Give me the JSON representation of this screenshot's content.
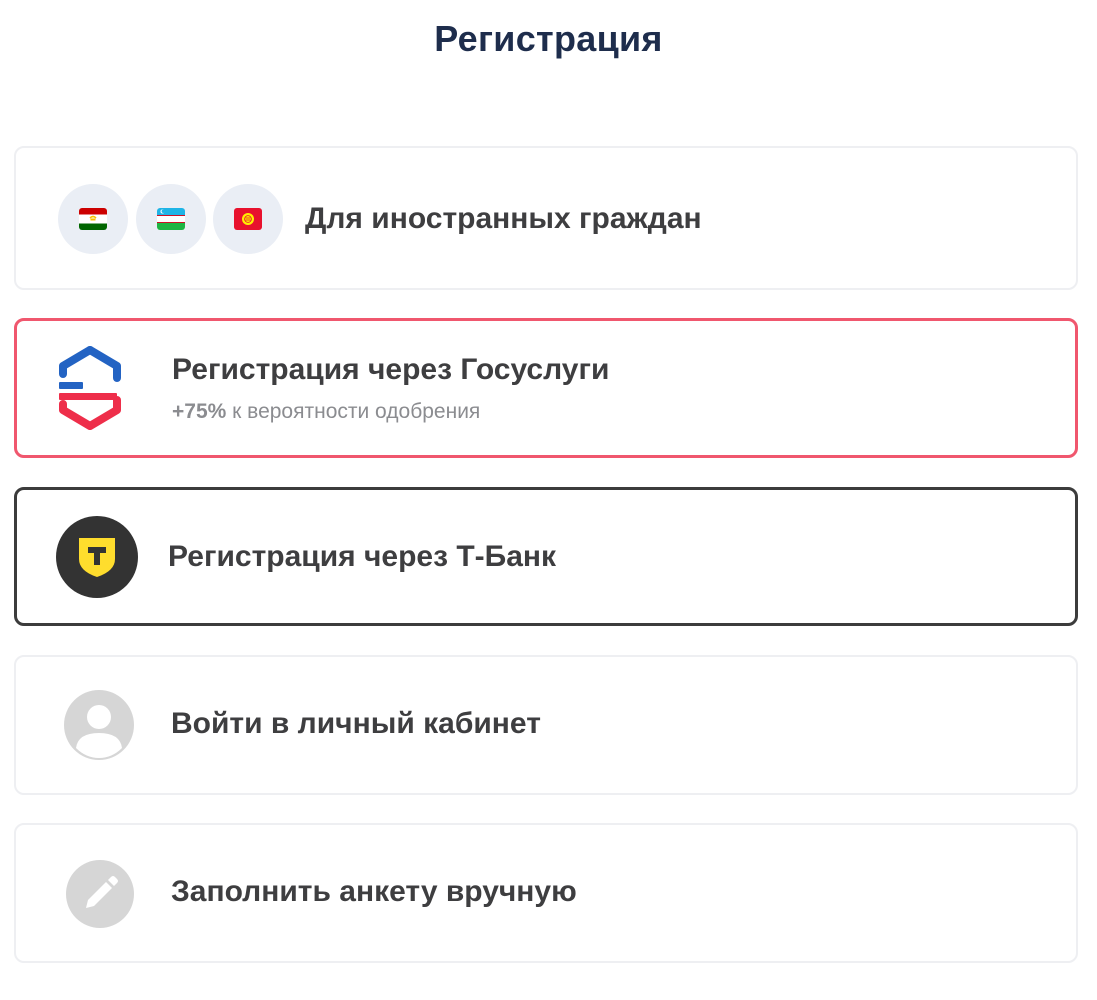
{
  "page": {
    "title": "Регистрация"
  },
  "options": {
    "foreign": {
      "label": "Для иностранных граждан",
      "flags": [
        "tajikistan-flag-icon",
        "uzbekistan-flag-icon",
        "kyrgyzstan-flag-icon"
      ]
    },
    "gosuslugi": {
      "label": "Регистрация через Госуслуги",
      "subtitle_percent": "+75%",
      "subtitle_rest": " к вероятности одобрения",
      "icon": "gosuslugi-icon",
      "accent_color": "#f0576e"
    },
    "tbank": {
      "label": "Регистрация через Т-Банк",
      "icon": "tbank-icon",
      "accent_color": "#3c3c3c"
    },
    "login": {
      "label": "Войти в личный кабинет",
      "icon": "user-icon"
    },
    "manual": {
      "label": "Заполнить анкету вручную",
      "icon": "pencil-icon"
    }
  },
  "colors": {
    "title": "#1e2d4c",
    "text": "#3e3e40",
    "subtitle": "#8b8c90",
    "border": "#eeeff2"
  }
}
